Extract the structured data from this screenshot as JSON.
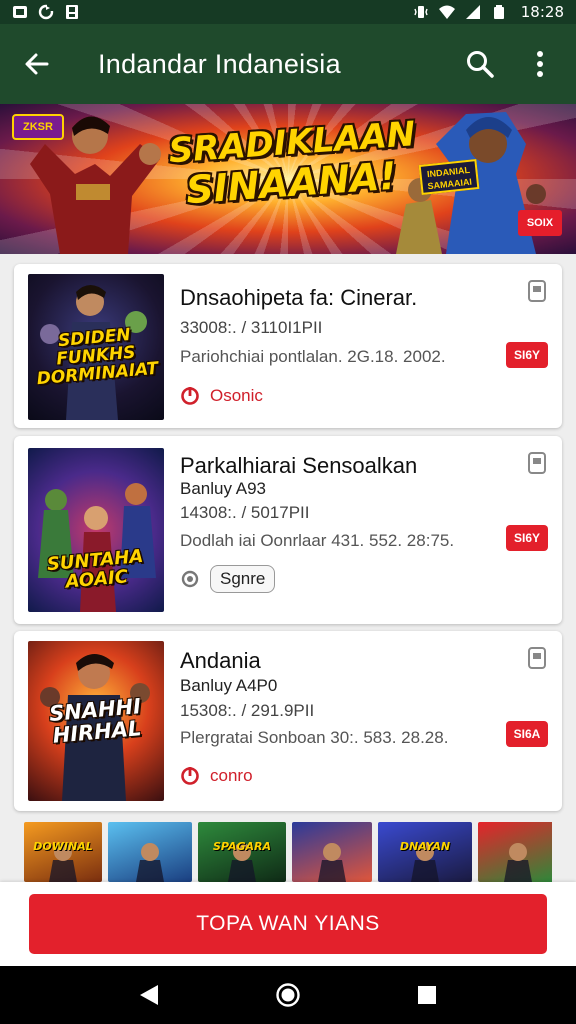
{
  "status_bar": {
    "time": "18:28",
    "left_icons": [
      "app-notification-icon",
      "sync-icon",
      "download-icon"
    ],
    "right_icons": [
      "vibrate-icon",
      "wifi-icon",
      "signal-icon",
      "battery-icon"
    ]
  },
  "app_bar": {
    "title": "Indandar Indaneisia",
    "back_icon": "arrow-back-icon",
    "search_icon": "search-icon",
    "menu_icon": "more-vert-icon"
  },
  "banner": {
    "headline_line1": "SRADIKLAAN",
    "headline_line2": "SINAANA!",
    "logo_text": "ZKSR",
    "sign_text": "INDANIAL SAMAAIAI",
    "corner_text": "SOIX"
  },
  "cards": [
    {
      "poster_text": "SDIDEN FUNKHS DORMINAIAT",
      "title": "Dnsaohipeta fa: Cinerar.",
      "subtitle": "",
      "stats": "33008:. / 3110I1PII",
      "description": "Pariohchiai pontlalan. 2G.18. 2002.",
      "tag": "SI6Y",
      "action_icon": "power-icon",
      "action_label": "Osonic",
      "action_style": "link"
    },
    {
      "poster_text": "SUNTAHA AOAIC",
      "title": "Parkalhiarai Sensoalkan",
      "subtitle": "Banluy A93",
      "stats": "14308:. / 5017PII",
      "description": "Dodlah iai Oonrlaar 431. 552. 28:75.",
      "tag": "SI6Y",
      "action_icon": "record-icon",
      "action_label": "Sgnre",
      "action_style": "pill"
    },
    {
      "poster_text": "SNAHHI HIRHAL",
      "title": "Andania",
      "subtitle": "Banluy A4P0",
      "stats": "15308:. / 291.9PII",
      "description": "Plergratai Sonboan 30:. 583. 28.28.",
      "tag": "SI6A",
      "action_icon": "power-icon",
      "action_label": "conro",
      "action_style": "link"
    }
  ],
  "strip": [
    {
      "label": "DOWINAL",
      "color1": "#f59b20",
      "color2": "#7a2e0f",
      "width": 78
    },
    {
      "label": "",
      "color1": "#5bc0f0",
      "color2": "#1a3e80",
      "width": 84
    },
    {
      "label": "SPAGARA",
      "color1": "#2e8a3c",
      "color2": "#0f2a16",
      "width": 88
    },
    {
      "label": "",
      "color1": "#2a3a9a",
      "color2": "#e0563b",
      "width": 80
    },
    {
      "label": "DNAYAN",
      "color1": "#3a4ad0",
      "color2": "#1a1a40",
      "width": 94
    },
    {
      "label": "",
      "color1": "#e6232b",
      "color2": "#2a8a3a",
      "width": 80
    }
  ],
  "cta": {
    "label": "TOPA WAN YIANS"
  },
  "nav": {
    "back_icon": "nav-back-icon",
    "home_icon": "nav-home-icon",
    "recents_icon": "nav-recents-icon"
  },
  "colors": {
    "app_bar": "#1f4a2c",
    "status_bar": "#163a24",
    "accent_red": "#e3212c"
  }
}
